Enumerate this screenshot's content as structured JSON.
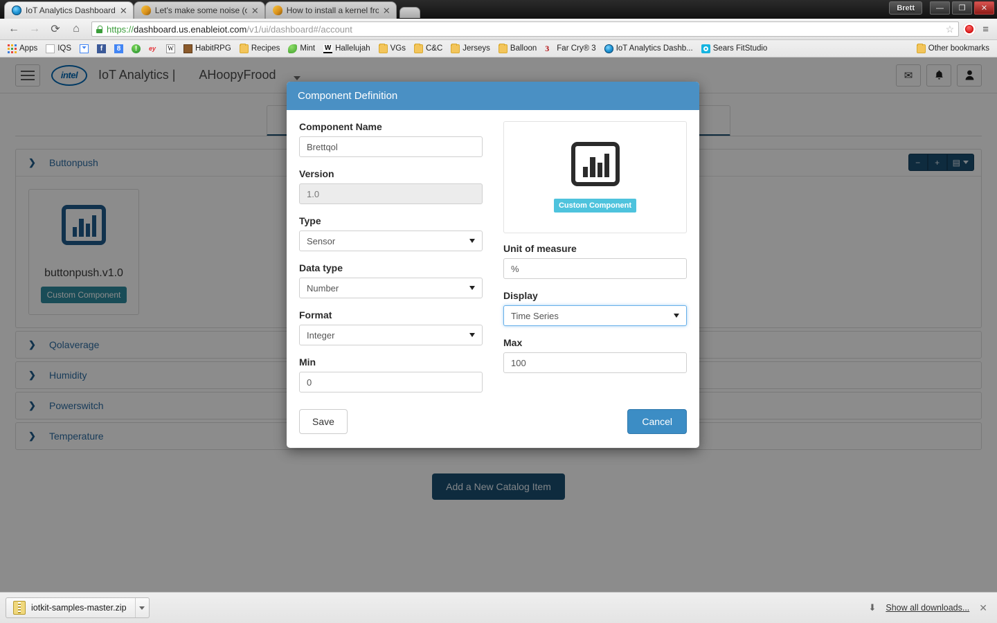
{
  "window": {
    "user_chip": "Brett",
    "minimize": "—",
    "restore": "❐",
    "close": "✕"
  },
  "browser": {
    "tabs": [
      {
        "title": "IoT Analytics Dashboard",
        "favicon": "iot-favicon",
        "active": true
      },
      {
        "title": "Let's make some noise (or",
        "favicon": "mango-favicon",
        "active": false
      },
      {
        "title": "How to install a kernel fro",
        "favicon": "mango-favicon",
        "active": false
      }
    ],
    "close_label": "✕",
    "back": "←",
    "forward": "→",
    "reload": "⟳",
    "home": "⌂",
    "url_scheme": "https://",
    "url_host": "dashboard.us.enableiot.com",
    "url_path": "/v1/ui/dashboard#/account",
    "star": "☆",
    "menu": "≡",
    "bookmarks": [
      {
        "label": "Apps",
        "icon": "apps-grid-icon"
      },
      {
        "label": "IQS",
        "icon": "page-icon"
      },
      {
        "label": "",
        "icon": "inbox-icon"
      },
      {
        "label": "",
        "icon": "facebook-icon",
        "glyph": "f"
      },
      {
        "label": "",
        "icon": "google-icon",
        "glyph": "8"
      },
      {
        "label": "",
        "icon": "exclamation-icon",
        "glyph": "!"
      },
      {
        "label": "",
        "icon": "ebay-icon",
        "glyph": "ey"
      },
      {
        "label": "",
        "icon": "wikipedia-icon",
        "glyph": "W"
      },
      {
        "label": "HabitRPG",
        "icon": "habitrpg-icon"
      },
      {
        "label": "Recipes",
        "icon": "folder-icon"
      },
      {
        "label": "Mint",
        "icon": "mint-leaf-icon"
      },
      {
        "label": "Hallelujah",
        "icon": "w-underline-icon",
        "glyph": "W"
      },
      {
        "label": "VGs",
        "icon": "folder-icon"
      },
      {
        "label": "C&C",
        "icon": "folder-icon"
      },
      {
        "label": "Jerseys",
        "icon": "folder-icon"
      },
      {
        "label": "Balloon",
        "icon": "folder-icon"
      },
      {
        "label": "Far Cry® 3",
        "icon": "farcry-icon",
        "glyph": "3"
      },
      {
        "label": "IoT Analytics Dashb...",
        "icon": "iot-favicon"
      },
      {
        "label": "Sears FitStudio",
        "icon": "sears-icon"
      }
    ],
    "other_bookmarks": "Other bookmarks"
  },
  "app": {
    "brand": "IoT Analytics |",
    "account": "AHoopyFrood",
    "logo_text": "intel",
    "header_icons": [
      {
        "name": "mail-icon",
        "glyph": "✉"
      },
      {
        "name": "bell-icon",
        "glyph": "🔔"
      },
      {
        "name": "user-icon",
        "glyph": "👤"
      }
    ],
    "catalog": {
      "sections": [
        {
          "label": "Buttonpush",
          "expanded": true
        },
        {
          "label": "Qolaverage",
          "expanded": false
        },
        {
          "label": "Humidity",
          "expanded": false
        },
        {
          "label": "Powerswitch",
          "expanded": false
        },
        {
          "label": "Temperature",
          "expanded": false
        }
      ],
      "tools": [
        {
          "name": "collapse-all-button",
          "glyph": "−"
        },
        {
          "name": "expand-all-button",
          "glyph": "+"
        },
        {
          "name": "view-options-button",
          "glyph": "▤"
        }
      ],
      "component_card": {
        "name": "buttonpush.v1.0",
        "badge": "Custom Component",
        "icon": "bar-chart-icon"
      },
      "add_button": "Add a New Catalog Item"
    }
  },
  "modal": {
    "title": "Component Definition",
    "fields": {
      "component_name_label": "Component Name",
      "component_name_value": "Brettqol",
      "version_label": "Version",
      "version_value": "1.0",
      "type_label": "Type",
      "type_value": "Sensor",
      "data_type_label": "Data type",
      "data_type_value": "Number",
      "unit_label": "Unit of measure",
      "unit_value": "%",
      "format_label": "Format",
      "format_value": "Integer",
      "display_label": "Display",
      "display_value": "Time Series",
      "min_label": "Min",
      "min_value": "0",
      "max_label": "Max",
      "max_value": "100"
    },
    "preview": {
      "icon": "bar-chart-icon",
      "badge": "Custom Component"
    },
    "save_label": "Save",
    "cancel_label": "Cancel"
  },
  "downloads": {
    "file_name": "iotkit-samples-master.zip",
    "show_all": "Show all downloads...",
    "close": "✕"
  },
  "colors": {
    "accent_blue": "#4a90c4",
    "dark_blue": "#1b4f72",
    "teal_badge": "#2e8b9e",
    "cyan_badge": "#4ec3dd",
    "link_blue": "#2c6ca3"
  }
}
